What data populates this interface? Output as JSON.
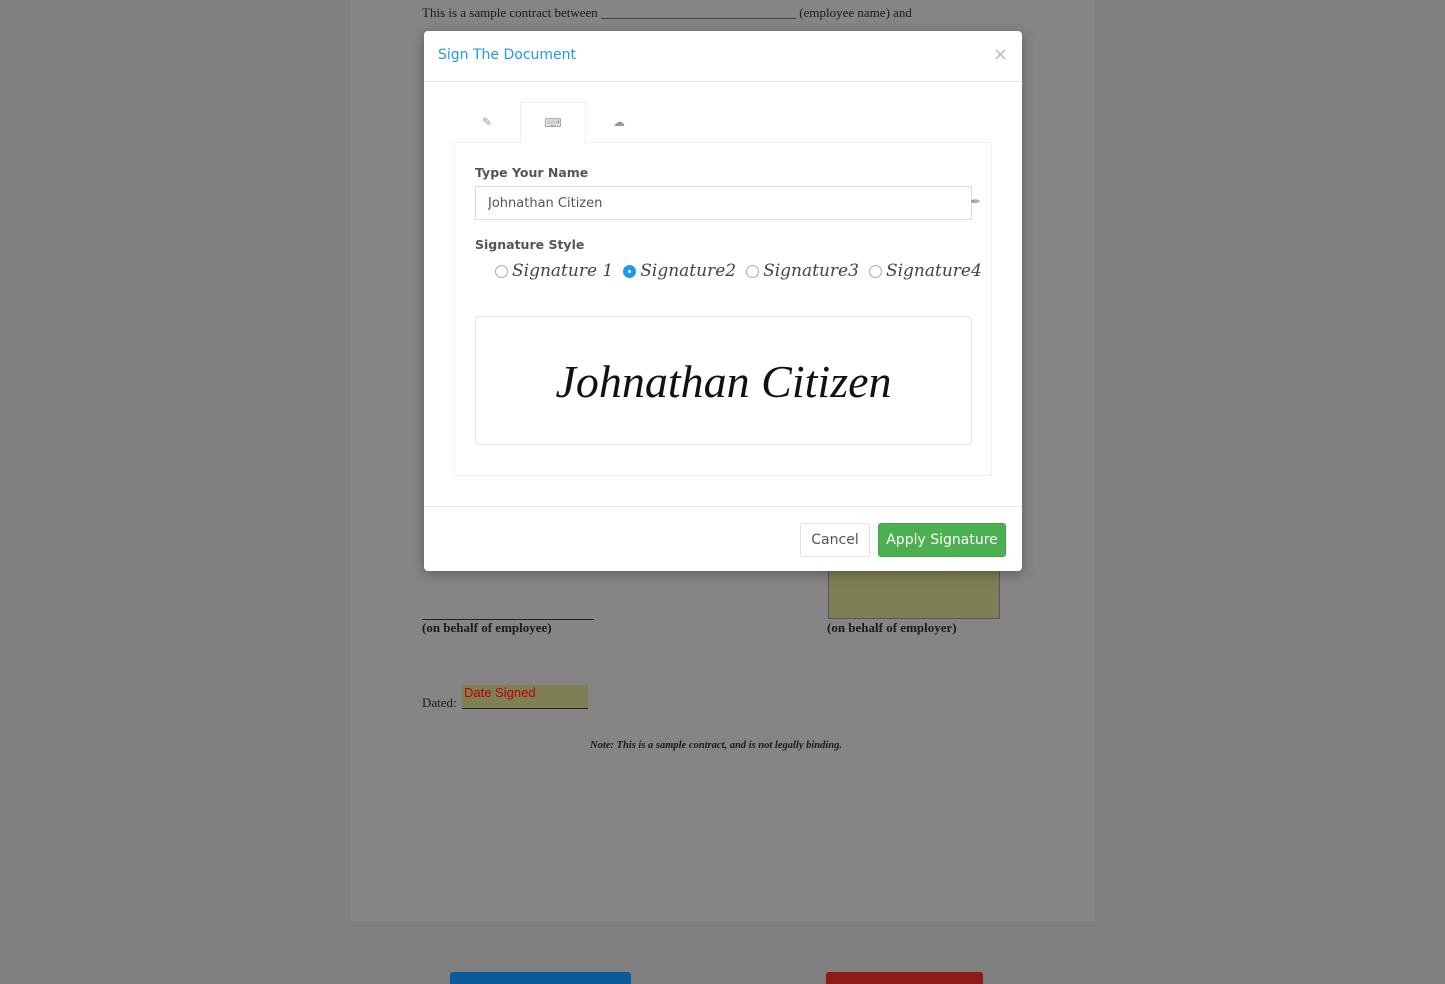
{
  "document": {
    "intro": "This is a sample contract between ______________________________ (employee name) and",
    "employee_sig_caption": "(on behalf of employee)",
    "employer_sig_caption": "(on behalf of employer)",
    "dated_label": "Dated:",
    "date_field_placeholder": "Date Signed",
    "note": "Note: This is a sample contract, and is not legally binding."
  },
  "modal": {
    "title": "Sign The Document",
    "close": "×",
    "tabs": [
      {
        "icon": "pencil-icon"
      },
      {
        "icon": "keyboard-icon",
        "active": true
      },
      {
        "icon": "cloud-upload-icon"
      }
    ],
    "name_label": "Type Your Name",
    "name_value": "Johnathan Citizen",
    "style_label": "Signature Style",
    "styles": [
      "Signature 1",
      "Signature2",
      "Signature3",
      "Signature4"
    ],
    "selected_style": "Signature2",
    "preview": "Johnathan Citizen",
    "cancel": "Cancel",
    "apply": "Apply Signature"
  },
  "colors": {
    "accent": "#2196f3",
    "apply": "#4caf50",
    "date_text": "#c00000"
  }
}
